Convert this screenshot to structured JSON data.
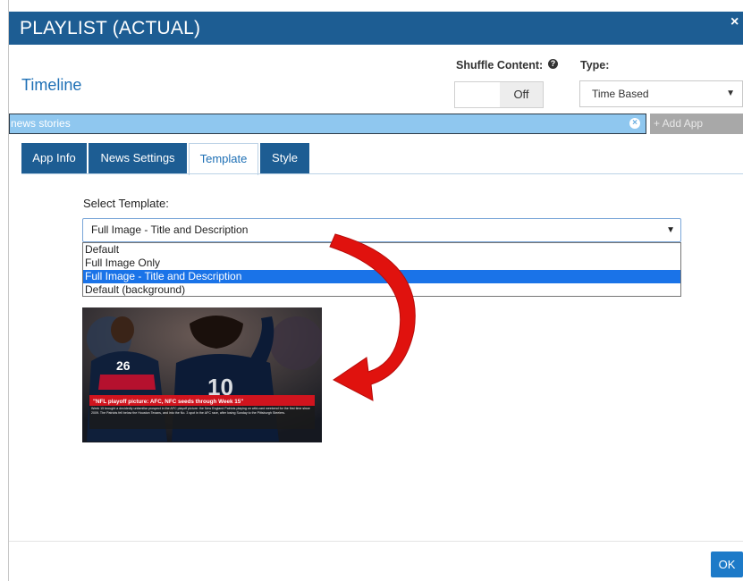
{
  "dialog": {
    "title": "PLAYLIST (ACTUAL)",
    "close_glyph": "×"
  },
  "timeline": {
    "title": "Timeline"
  },
  "shuffle": {
    "label": "Shuffle Content:",
    "value": "Off"
  },
  "type": {
    "label": "Type:",
    "value": "Time Based"
  },
  "app_bar": {
    "app_name": "news stories",
    "add_app_label": "+ Add App"
  },
  "tabs": [
    {
      "label": "App Info"
    },
    {
      "label": "News Settings"
    },
    {
      "label": "Template",
      "active": true
    },
    {
      "label": "Style"
    }
  ],
  "template": {
    "label": "Select Template:",
    "selected": "Full Image - Title and Description",
    "options": [
      "Default",
      "Full Image Only",
      "Full Image - Title and Description",
      "Default (background)"
    ]
  },
  "preview": {
    "headline": "\"NFL playoff picture: AFC, NFC seeds through Week 15\"",
    "body": "Week 15 brought a decidedly unfamiliar prospect in the AFC playoff picture: the New England Patriots playing on wild-card weekend for the first time since 2009. The Patriots fell below the Houston Texans, and into the No. 3 spot in the AFC race, after losing Sunday to the Pittsburgh Steelers."
  },
  "footer": {
    "ok_label": "OK"
  },
  "colors": {
    "header_blue": "#1d5d93",
    "accent_blue": "#1d6fb5",
    "app_bar": "#8fc7ef",
    "selection": "#1a73e8",
    "arrow_red": "#e0120e"
  }
}
